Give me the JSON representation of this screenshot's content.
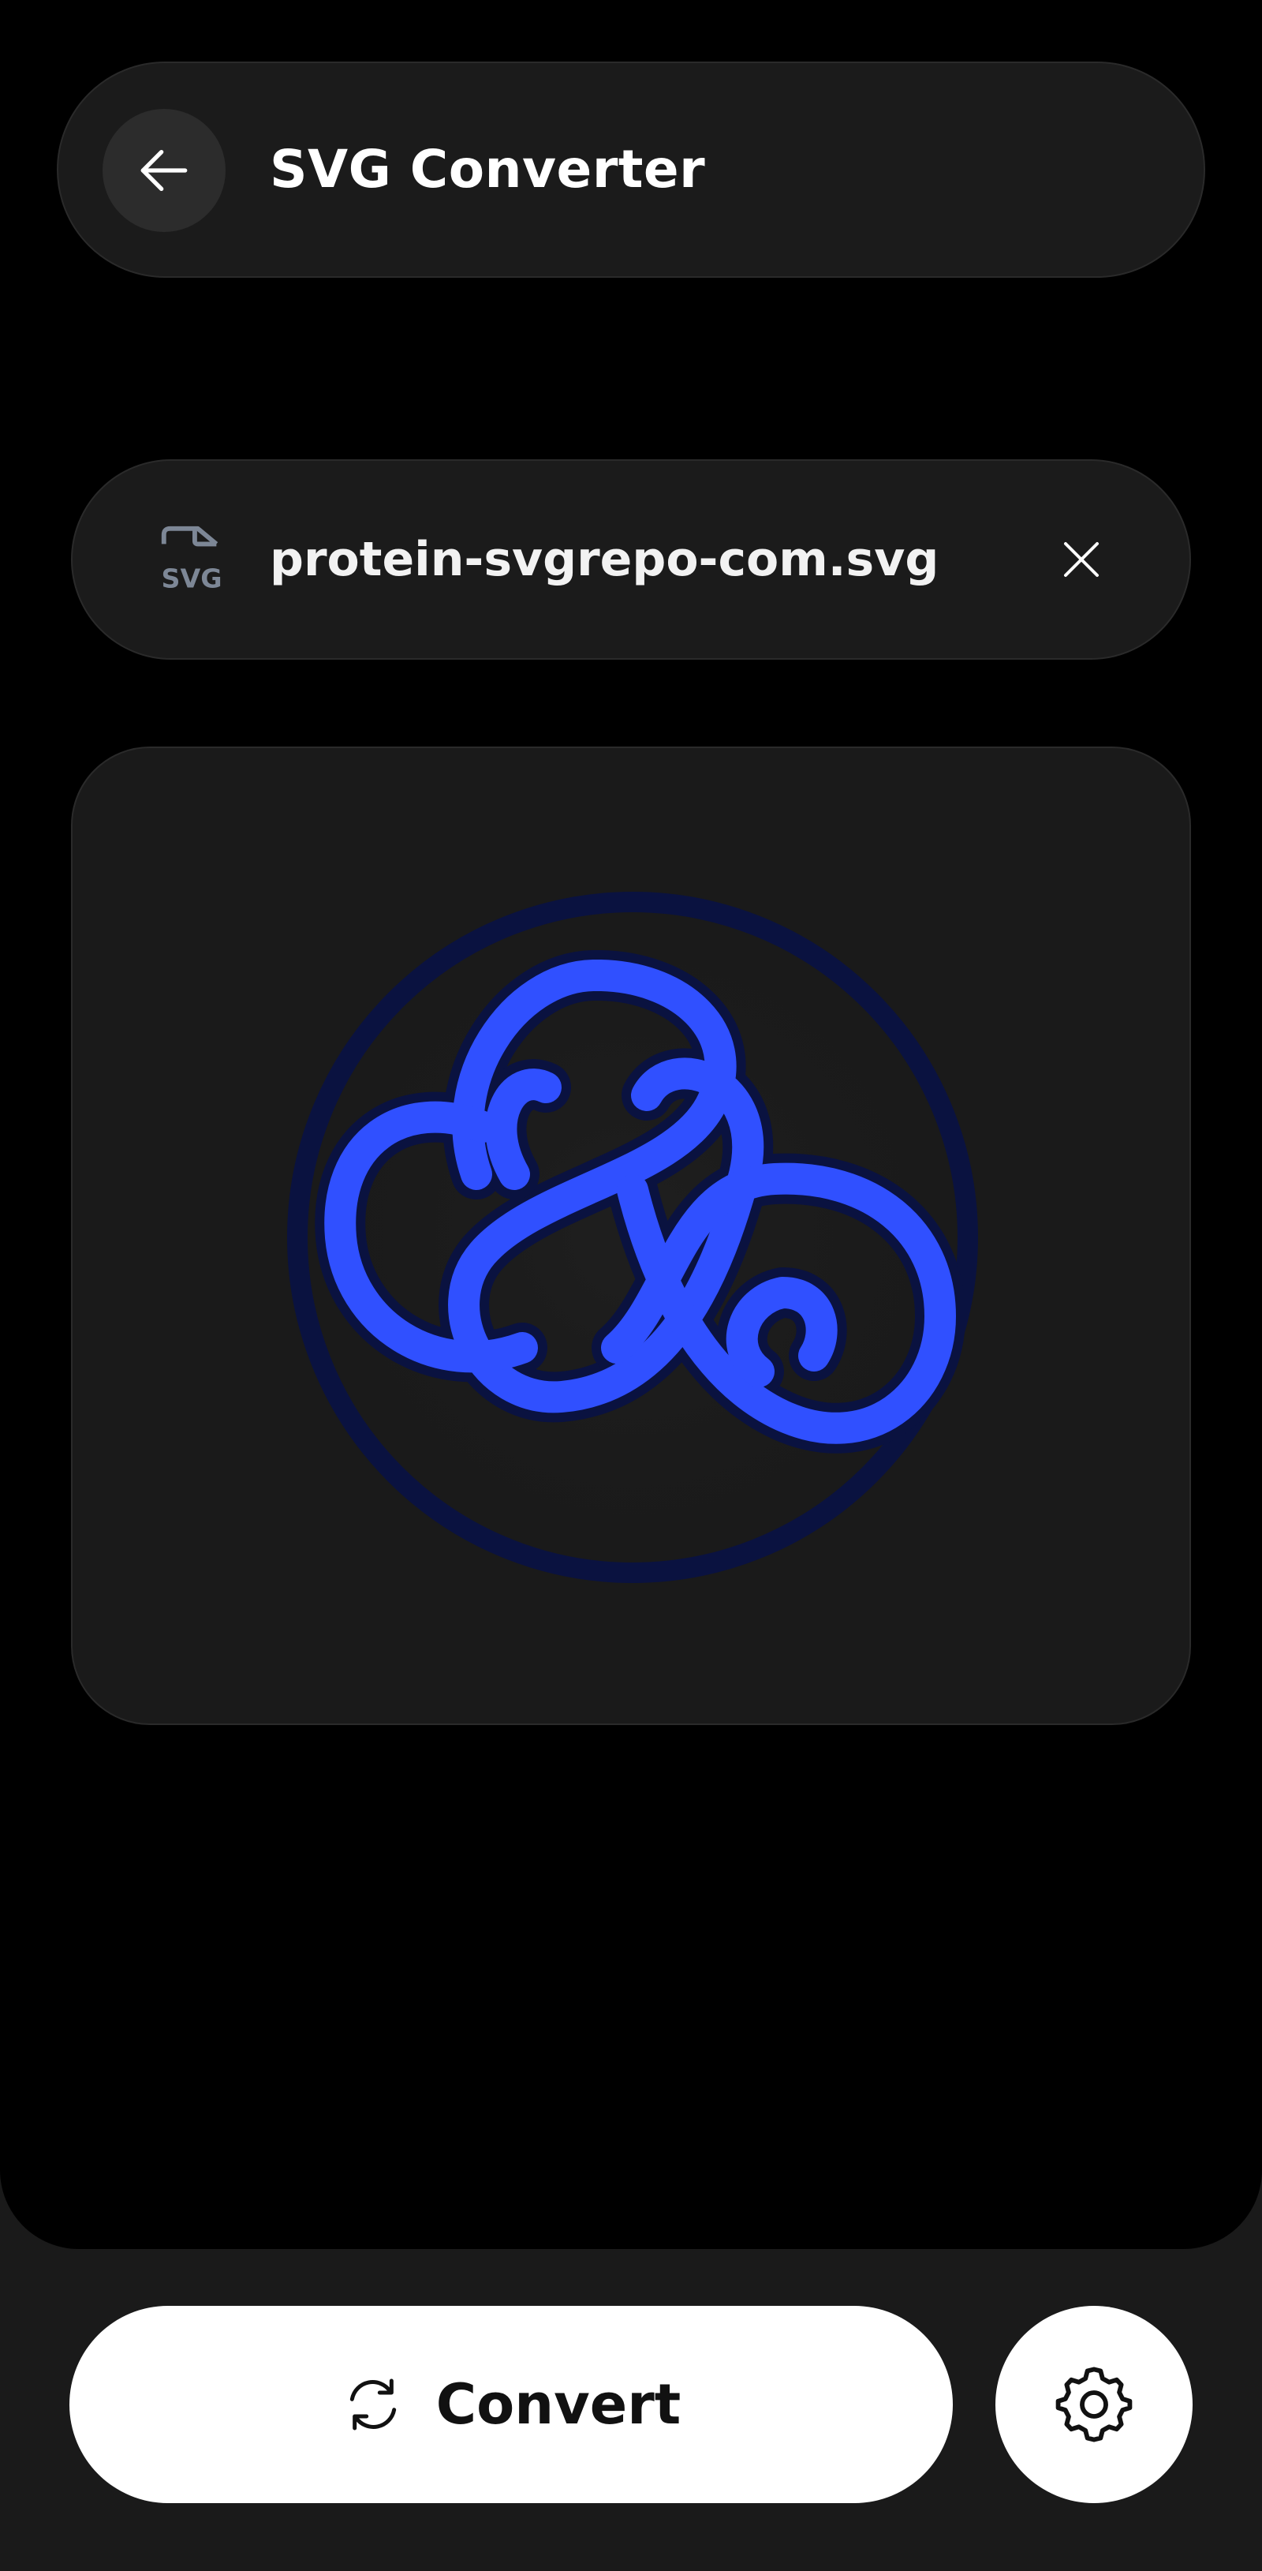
{
  "header": {
    "title": "SVG Converter",
    "back_icon": "arrow-left-icon"
  },
  "file": {
    "name": "protein-svgrepo-com.svg",
    "type_label": "SVG",
    "file_icon": "svg-file-icon",
    "remove_icon": "close-icon"
  },
  "preview": {
    "image_name": "protein-knot-illustration",
    "colors": {
      "stroke": "#3050ff",
      "ring": "#0a1240"
    }
  },
  "actions": {
    "convert_label": "Convert",
    "convert_icon": "refresh-icon",
    "settings_icon": "gear-icon"
  },
  "theme": {
    "background": "#000000",
    "surface": "#1b1b1b",
    "accent": "#3050ff"
  }
}
